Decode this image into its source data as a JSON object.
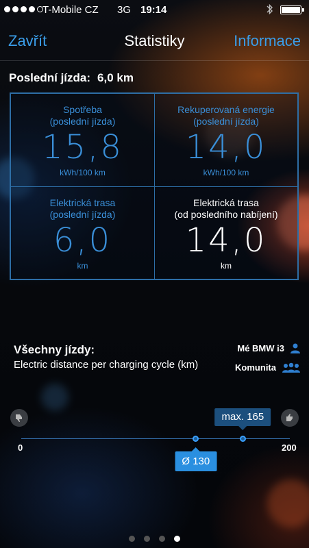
{
  "status_bar": {
    "carrier": "T-Mobile CZ",
    "network": "3G",
    "time": "19:14",
    "signal_bars_filled": 4,
    "signal_bars_total": 5,
    "battery_level": 1.0
  },
  "nav": {
    "left_button": "Zavřít",
    "title": "Statistiky",
    "right_button": "Informace"
  },
  "last_trip": {
    "label": "Poslední jízda:",
    "value": "6,0 km"
  },
  "stats": [
    {
      "title_line1": "Spotřeba",
      "title_line2": "(poslední jízda)",
      "value": "15,8",
      "unit": "kWh/100 km"
    },
    {
      "title_line1": "Rekuperovaná energie",
      "title_line2": "(poslední jízda)",
      "value": "14,0",
      "unit": "kWh/100 km"
    },
    {
      "title_line1": "Elektrická trasa",
      "title_line2": "(poslední jízda)",
      "value": "6,0",
      "unit": "km"
    },
    {
      "title_line1": "Elektrická trasa",
      "title_line2": "(od posledního nabíjení)",
      "value": "14,0",
      "unit": "km"
    }
  ],
  "all_trips": {
    "heading": "Všechny jízdy:",
    "description": "Electric distance per charging cycle (km)",
    "legend": [
      {
        "label": "Mé BMW i3",
        "icon": "person-icon"
      },
      {
        "label": "Komunita",
        "icon": "people-icon"
      }
    ]
  },
  "range_scale": {
    "min_label": "0",
    "max_label": "200",
    "min": 0,
    "max": 200,
    "average": 130,
    "maximum": 165,
    "average_label": "Ø 130",
    "maximum_label": "max. 165"
  },
  "pagination": {
    "total": 4,
    "active_index": 3
  },
  "colors": {
    "accent": "#3a9de8",
    "grid_border": "#2d6ea6",
    "avg_badge": "#2a8fe0",
    "max_badge": "#1c4f7d"
  }
}
